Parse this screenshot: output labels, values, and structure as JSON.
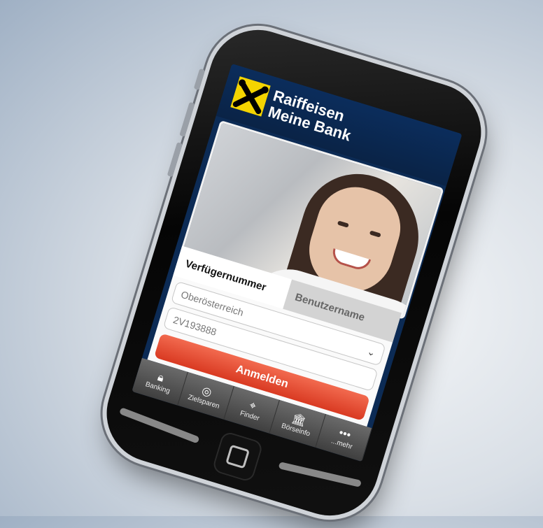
{
  "app": {
    "brand_line1": "Raiffeisen",
    "brand_line2": "Meine Bank",
    "logo_icon": "raiffeisen-cross-logo"
  },
  "login": {
    "tabs": [
      {
        "label": "Verfügernummer",
        "active": true
      },
      {
        "label": "Benutzername",
        "active": false
      }
    ],
    "region_value": "Oberösterreich",
    "account_value": "2V193888",
    "login_button": "Anmelden"
  },
  "tabbar": {
    "items": [
      {
        "label": "Banking",
        "icon": "lock-icon"
      },
      {
        "label": "Zielsparen",
        "icon": "target-icon"
      },
      {
        "label": "Finder",
        "icon": "crosshair-icon"
      },
      {
        "label": "Börseinfo",
        "icon": "bank-building-icon"
      },
      {
        "label": "...mehr",
        "icon": "more-dots-icon"
      }
    ]
  },
  "colors": {
    "brand_yellow": "#f4d400",
    "header_navy": "#0b2d5c",
    "button_red": "#d93a22"
  }
}
